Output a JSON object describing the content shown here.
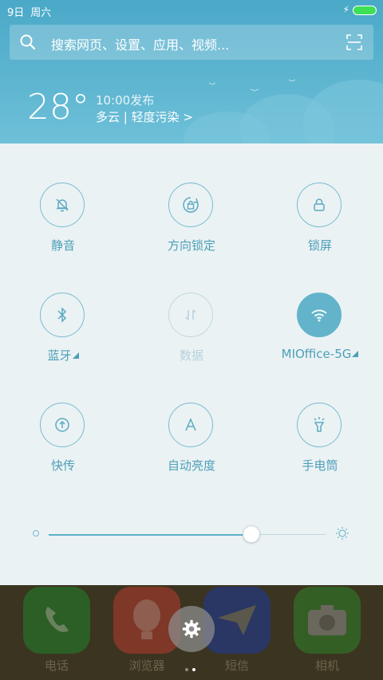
{
  "status_bar": {
    "date": "9日",
    "weekday": "周六",
    "battery_color": "#3ddf55"
  },
  "search": {
    "placeholder": "搜索网页、设置、应用、视频..."
  },
  "weather": {
    "temperature": "28°",
    "published": "10:00发布",
    "condition": "多云 | 轻度污染 >"
  },
  "toggles": [
    {
      "label": "静音",
      "icon": "bell-mute-icon",
      "state": "off"
    },
    {
      "label": "方向锁定",
      "icon": "rotation-lock-icon",
      "state": "off"
    },
    {
      "label": "锁屏",
      "icon": "lock-icon",
      "state": "off"
    },
    {
      "label": "蓝牙",
      "icon": "bluetooth-icon",
      "state": "off"
    },
    {
      "label": "数据",
      "icon": "mobile-data-icon",
      "state": "disabled"
    },
    {
      "label": "MIOffice-5G",
      "icon": "wifi-icon",
      "state": "on"
    },
    {
      "label": "快传",
      "icon": "share-transfer-icon",
      "state": "off"
    },
    {
      "label": "自动亮度",
      "icon": "auto-brightness-icon",
      "state": "off"
    },
    {
      "label": "手电筒",
      "icon": "flashlight-icon",
      "state": "off"
    }
  ],
  "brightness": {
    "level": 0.73
  },
  "dock": {
    "apps": [
      {
        "label": "电话",
        "icon": "phone-icon",
        "color": "#1f8a2c"
      },
      {
        "label": "浏览器",
        "icon": "browser-icon",
        "color": "#c23a2e"
      },
      {
        "label": "短信",
        "icon": "message-icon",
        "color": "#1b3aa8"
      },
      {
        "label": "相机",
        "icon": "camera-icon",
        "color": "#2d8a2a"
      }
    ]
  },
  "page_indicator": {
    "count": 2,
    "active": 1
  },
  "colors": {
    "accent": "#4d9fb8",
    "active_toggle": "#63b4ca",
    "panel_bg": "#ebf2f4"
  }
}
